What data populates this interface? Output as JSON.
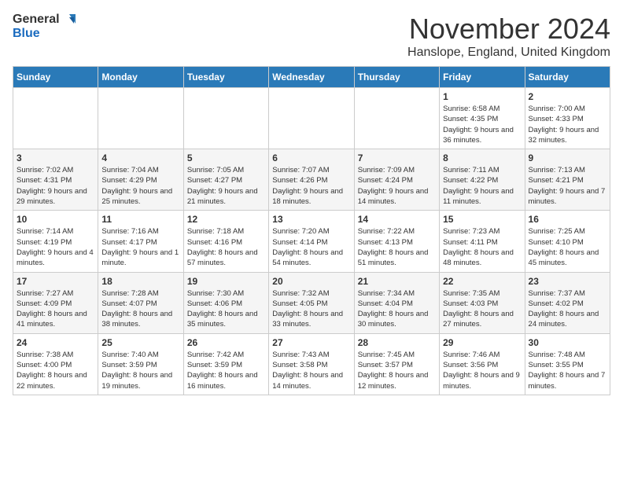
{
  "logo": {
    "text_general": "General",
    "text_blue": "Blue"
  },
  "title": {
    "month": "November 2024",
    "location": "Hanslope, England, United Kingdom"
  },
  "headers": [
    "Sunday",
    "Monday",
    "Tuesday",
    "Wednesday",
    "Thursday",
    "Friday",
    "Saturday"
  ],
  "weeks": [
    [
      {
        "day": "",
        "info": ""
      },
      {
        "day": "",
        "info": ""
      },
      {
        "day": "",
        "info": ""
      },
      {
        "day": "",
        "info": ""
      },
      {
        "day": "",
        "info": ""
      },
      {
        "day": "1",
        "info": "Sunrise: 6:58 AM\nSunset: 4:35 PM\nDaylight: 9 hours and 36 minutes."
      },
      {
        "day": "2",
        "info": "Sunrise: 7:00 AM\nSunset: 4:33 PM\nDaylight: 9 hours and 32 minutes."
      }
    ],
    [
      {
        "day": "3",
        "info": "Sunrise: 7:02 AM\nSunset: 4:31 PM\nDaylight: 9 hours and 29 minutes."
      },
      {
        "day": "4",
        "info": "Sunrise: 7:04 AM\nSunset: 4:29 PM\nDaylight: 9 hours and 25 minutes."
      },
      {
        "day": "5",
        "info": "Sunrise: 7:05 AM\nSunset: 4:27 PM\nDaylight: 9 hours and 21 minutes."
      },
      {
        "day": "6",
        "info": "Sunrise: 7:07 AM\nSunset: 4:26 PM\nDaylight: 9 hours and 18 minutes."
      },
      {
        "day": "7",
        "info": "Sunrise: 7:09 AM\nSunset: 4:24 PM\nDaylight: 9 hours and 14 minutes."
      },
      {
        "day": "8",
        "info": "Sunrise: 7:11 AM\nSunset: 4:22 PM\nDaylight: 9 hours and 11 minutes."
      },
      {
        "day": "9",
        "info": "Sunrise: 7:13 AM\nSunset: 4:21 PM\nDaylight: 9 hours and 7 minutes."
      }
    ],
    [
      {
        "day": "10",
        "info": "Sunrise: 7:14 AM\nSunset: 4:19 PM\nDaylight: 9 hours and 4 minutes."
      },
      {
        "day": "11",
        "info": "Sunrise: 7:16 AM\nSunset: 4:17 PM\nDaylight: 9 hours and 1 minute."
      },
      {
        "day": "12",
        "info": "Sunrise: 7:18 AM\nSunset: 4:16 PM\nDaylight: 8 hours and 57 minutes."
      },
      {
        "day": "13",
        "info": "Sunrise: 7:20 AM\nSunset: 4:14 PM\nDaylight: 8 hours and 54 minutes."
      },
      {
        "day": "14",
        "info": "Sunrise: 7:22 AM\nSunset: 4:13 PM\nDaylight: 8 hours and 51 minutes."
      },
      {
        "day": "15",
        "info": "Sunrise: 7:23 AM\nSunset: 4:11 PM\nDaylight: 8 hours and 48 minutes."
      },
      {
        "day": "16",
        "info": "Sunrise: 7:25 AM\nSunset: 4:10 PM\nDaylight: 8 hours and 45 minutes."
      }
    ],
    [
      {
        "day": "17",
        "info": "Sunrise: 7:27 AM\nSunset: 4:09 PM\nDaylight: 8 hours and 41 minutes."
      },
      {
        "day": "18",
        "info": "Sunrise: 7:28 AM\nSunset: 4:07 PM\nDaylight: 8 hours and 38 minutes."
      },
      {
        "day": "19",
        "info": "Sunrise: 7:30 AM\nSunset: 4:06 PM\nDaylight: 8 hours and 35 minutes."
      },
      {
        "day": "20",
        "info": "Sunrise: 7:32 AM\nSunset: 4:05 PM\nDaylight: 8 hours and 33 minutes."
      },
      {
        "day": "21",
        "info": "Sunrise: 7:34 AM\nSunset: 4:04 PM\nDaylight: 8 hours and 30 minutes."
      },
      {
        "day": "22",
        "info": "Sunrise: 7:35 AM\nSunset: 4:03 PM\nDaylight: 8 hours and 27 minutes."
      },
      {
        "day": "23",
        "info": "Sunrise: 7:37 AM\nSunset: 4:02 PM\nDaylight: 8 hours and 24 minutes."
      }
    ],
    [
      {
        "day": "24",
        "info": "Sunrise: 7:38 AM\nSunset: 4:00 PM\nDaylight: 8 hours and 22 minutes."
      },
      {
        "day": "25",
        "info": "Sunrise: 7:40 AM\nSunset: 3:59 PM\nDaylight: 8 hours and 19 minutes."
      },
      {
        "day": "26",
        "info": "Sunrise: 7:42 AM\nSunset: 3:59 PM\nDaylight: 8 hours and 16 minutes."
      },
      {
        "day": "27",
        "info": "Sunrise: 7:43 AM\nSunset: 3:58 PM\nDaylight: 8 hours and 14 minutes."
      },
      {
        "day": "28",
        "info": "Sunrise: 7:45 AM\nSunset: 3:57 PM\nDaylight: 8 hours and 12 minutes."
      },
      {
        "day": "29",
        "info": "Sunrise: 7:46 AM\nSunset: 3:56 PM\nDaylight: 8 hours and 9 minutes."
      },
      {
        "day": "30",
        "info": "Sunrise: 7:48 AM\nSunset: 3:55 PM\nDaylight: 8 hours and 7 minutes."
      }
    ]
  ]
}
